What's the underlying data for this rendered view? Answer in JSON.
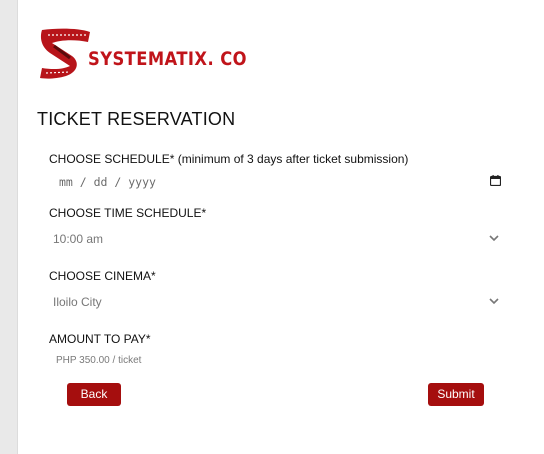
{
  "brand": {
    "name": "SYSTEMATIX. CO",
    "color": "#c0141a"
  },
  "form": {
    "title": "TICKET RESERVATION",
    "schedule_label": "CHOOSE SCHEDULE* (minimum of 3 days after ticket submission)",
    "schedule_placeholder": "mm / dd / yyyy",
    "time_label": "CHOOSE TIME SCHEDULE*",
    "time_value": "10:00 am",
    "cinema_label": "CHOOSE CINEMA*",
    "cinema_value": "Iloilo City",
    "amount_label": "AMOUNT TO PAY*",
    "amount_value": "PHP 350.00 / ticket"
  },
  "buttons": {
    "back": "Back",
    "submit": "Submit"
  },
  "icons": {
    "date": "calendar-icon",
    "select": "chevron-down-icon"
  },
  "colors": {
    "button": "#a50e0e",
    "accent": "#c0141a"
  }
}
